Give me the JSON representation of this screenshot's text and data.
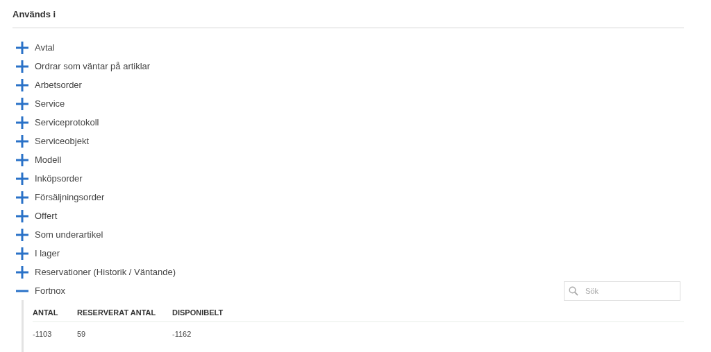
{
  "section_title": "Används i",
  "groups": [
    {
      "label": "Avtal",
      "expanded": false
    },
    {
      "label": "Ordrar som väntar på artiklar",
      "expanded": false
    },
    {
      "label": "Arbetsorder",
      "expanded": false
    },
    {
      "label": "Service",
      "expanded": false
    },
    {
      "label": "Serviceprotokoll",
      "expanded": false
    },
    {
      "label": "Serviceobjekt",
      "expanded": false
    },
    {
      "label": "Modell",
      "expanded": false
    },
    {
      "label": "Inköpsorder",
      "expanded": false
    },
    {
      "label": "Försäljningsorder",
      "expanded": false
    },
    {
      "label": "Offert",
      "expanded": false
    },
    {
      "label": "Som underartikel",
      "expanded": false
    },
    {
      "label": "I lager",
      "expanded": false
    },
    {
      "label": "Reservationer (Historik / Väntande)",
      "expanded": false
    },
    {
      "label": "Fortnox",
      "expanded": true,
      "search": {
        "placeholder": "Sök"
      },
      "table": {
        "columns": [
          "ANTAL",
          "RESERVERAT ANTAL",
          "DISPONIBELT"
        ],
        "rows": [
          [
            "-1103",
            "59",
            "-1162"
          ]
        ]
      }
    }
  ]
}
